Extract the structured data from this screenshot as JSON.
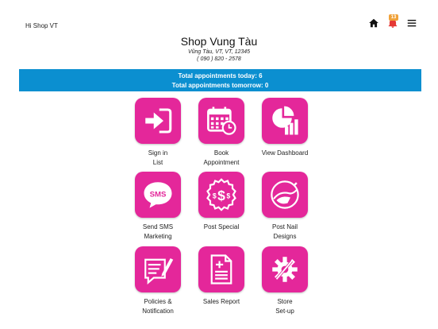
{
  "topbar": {
    "greeting": "Hi Shop VT",
    "notification_count": "13",
    "icons": [
      "home-icon",
      "bell-icon",
      "menu-icon"
    ]
  },
  "header": {
    "shop_name": "Shop Vung Tàu",
    "address": "Vũng Tàu, VT, VT, 12345",
    "phone": "( 090 ) 820 - 2578"
  },
  "banner": {
    "line1": "Total appointments today: 6",
    "line2": "Total appointments tomorrow: 0",
    "color": "#0b8fd0"
  },
  "accent": "#e4279a",
  "tiles": {
    "sign_in": {
      "line1": "Sign in",
      "line2": "List"
    },
    "book": {
      "line1": "Book",
      "line2": "Appointment"
    },
    "dashboard": {
      "line1": "View Dashboard"
    },
    "sms": {
      "line1": "Send SMS",
      "line2": "Marketing",
      "icon_text": "SMS"
    },
    "special": {
      "line1": "Post Special"
    },
    "nail": {
      "line1": "Post Nail",
      "line2": "Designs"
    },
    "policies": {
      "line1": "Policies &",
      "line2": "Notification"
    },
    "sales": {
      "line1": "Sales Report"
    },
    "store": {
      "line1": "Store",
      "line2": "Set-up"
    }
  }
}
